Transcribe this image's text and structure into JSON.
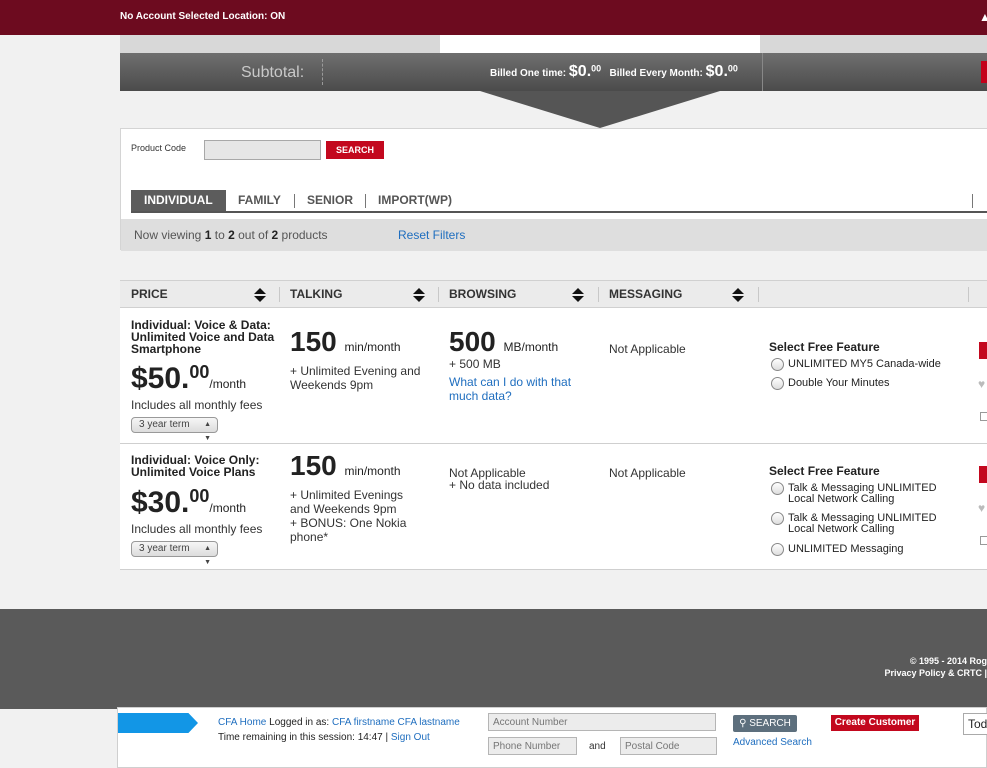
{
  "topbar": {
    "status": "No Account Selected  Location: ON",
    "cart_icon": "cart-icon"
  },
  "subtotal": {
    "label": "Subtotal:",
    "billed_once_label": "Billed One time:",
    "billed_once_dollars": "$0.",
    "billed_once_cents": "00",
    "billed_monthly_label": "Billed Every Month:",
    "billed_monthly_dollars": "$0.",
    "billed_monthly_cents": "00"
  },
  "search": {
    "product_code_label": "Product Code",
    "product_code_value": "",
    "search_button": "SEARCH"
  },
  "category_tabs": [
    "INDIVIDUAL",
    "FAMILY",
    "SENIOR",
    "IMPORT(WP)"
  ],
  "viewing": {
    "prefix": "Now viewing",
    "from": "1",
    "to_word": "to",
    "to": "2",
    "out_of_word": "out of",
    "total": "2",
    "suffix": "products",
    "reset_filters": "Reset Filters"
  },
  "table": {
    "headers": [
      "PRICE",
      "TALKING",
      "BROWSING",
      "MESSAGING"
    ],
    "rows": [
      {
        "name": "Individual: Voice & Data: Unlimited Voice and Data Smartphone",
        "price_dollars": "$50.",
        "price_cents": "00",
        "price_per": "/month",
        "includes": "Includes all monthly fees",
        "term": "3 year term",
        "talk_minutes": "150",
        "talk_unit": "min/month",
        "talk_extra": "+ Unlimited Evening and Weekends 9pm",
        "browse_amount": "500",
        "browse_unit": "MB/month",
        "browse_extra": "+ 500 MB",
        "browse_link": "What can I do with that much data?",
        "messaging": "Not Applicable",
        "feature_title": "Select Free Feature",
        "features": [
          "UNLIMITED MY5 Canada-wide",
          "Double Your Minutes"
        ]
      },
      {
        "name": "Individual: Voice Only: Unlimited Voice Plans",
        "price_dollars": "$30.",
        "price_cents": "00",
        "price_per": "/month",
        "includes": "Includes all monthly fees",
        "term": "3 year term",
        "talk_minutes": "150",
        "talk_unit": "min/month",
        "talk_extra": "+ Unlimited Evenings and Weekends 9pm",
        "talk_bonus": "+ BONUS: One Nokia phone*",
        "browse_text": "Not Applicable",
        "browse_extra": "+ No data included",
        "messaging": "Not Applicable",
        "feature_title": "Select Free Feature",
        "features": [
          "Talk & Messaging UNLIMITED Local Network Calling",
          "Talk & Messaging UNLIMITED Local Network Calling",
          "UNLIMITED Messaging"
        ]
      }
    ]
  },
  "footer": {
    "copyright": "© 1995 - 2014 Rog",
    "links": "Privacy Policy & CRTC |"
  },
  "bottombar": {
    "cfa_home": "CFA Home",
    "logged_in_as": "Logged in as:",
    "user_name": "CFA firstname CFA lastname",
    "time_label": "Time remaining in this session:",
    "time_value": "14:47",
    "separator": "|",
    "sign_out": "Sign Out",
    "account_number_placeholder": "Account Number",
    "phone_number_placeholder": "Phone Number",
    "and": "and",
    "postal_code_placeholder": "Postal Code",
    "search_button": "SEARCH",
    "advanced_search": "Advanced Search",
    "create_customer": "Create Customer",
    "todo": "Tod"
  },
  "colors": {
    "topbar": "#6d0b1f",
    "accent_red": "#c3081e",
    "link_blue": "#1f6ebf",
    "arrow_blue": "#1296e6"
  }
}
